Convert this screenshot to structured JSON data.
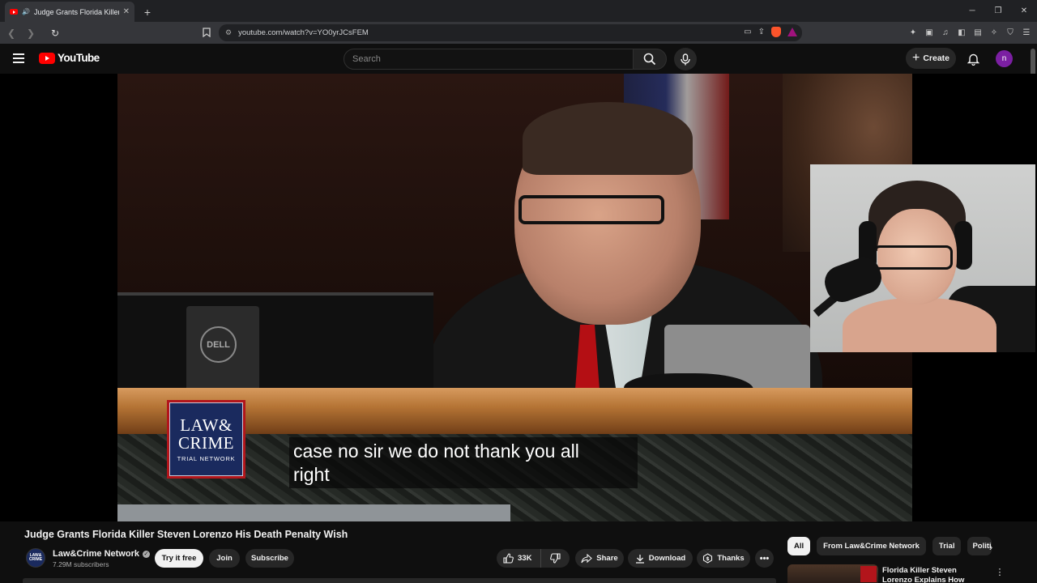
{
  "browser": {
    "tab_title": "Judge Grants Florida Killer Steven Lorenzo His Death Penalty Wish",
    "url": "youtube.com/watch?v=YO0yrJCsFEM"
  },
  "header": {
    "logo_text": "YouTube",
    "search_placeholder": "Search",
    "create_label": "Create",
    "avatar_letter": "n"
  },
  "video": {
    "channel_watermark": [
      "LAW&",
      "CRIME",
      "TRIAL NETWORK"
    ],
    "captions": [
      "case no sir we do not thank you all",
      "right"
    ],
    "title": "Judge Grants Florida Killer Steven Lorenzo His Death Penalty Wish"
  },
  "channel": {
    "name": "Law&Crime Network",
    "subscribers": "7.29M subscribers",
    "avatar_text": "LAW& CRIME"
  },
  "actions": {
    "try_label": "Try it free",
    "join_label": "Join",
    "subscribe_label": "Subscribe",
    "like_count": "33K",
    "share_label": "Share",
    "download_label": "Download",
    "thanks_label": "Thanks"
  },
  "chips": [
    "All",
    "From Law&Crime Network",
    "Trial",
    "Politics"
  ],
  "recommendation": {
    "title": "Florida Killer Steven Lorenzo Explains How BDSM Mishap"
  },
  "colors": {
    "brand_red": "#ff0000",
    "background": "#0f0f0f",
    "chip_active": "#f1f1f1",
    "avatar": "#7b1fa2"
  }
}
